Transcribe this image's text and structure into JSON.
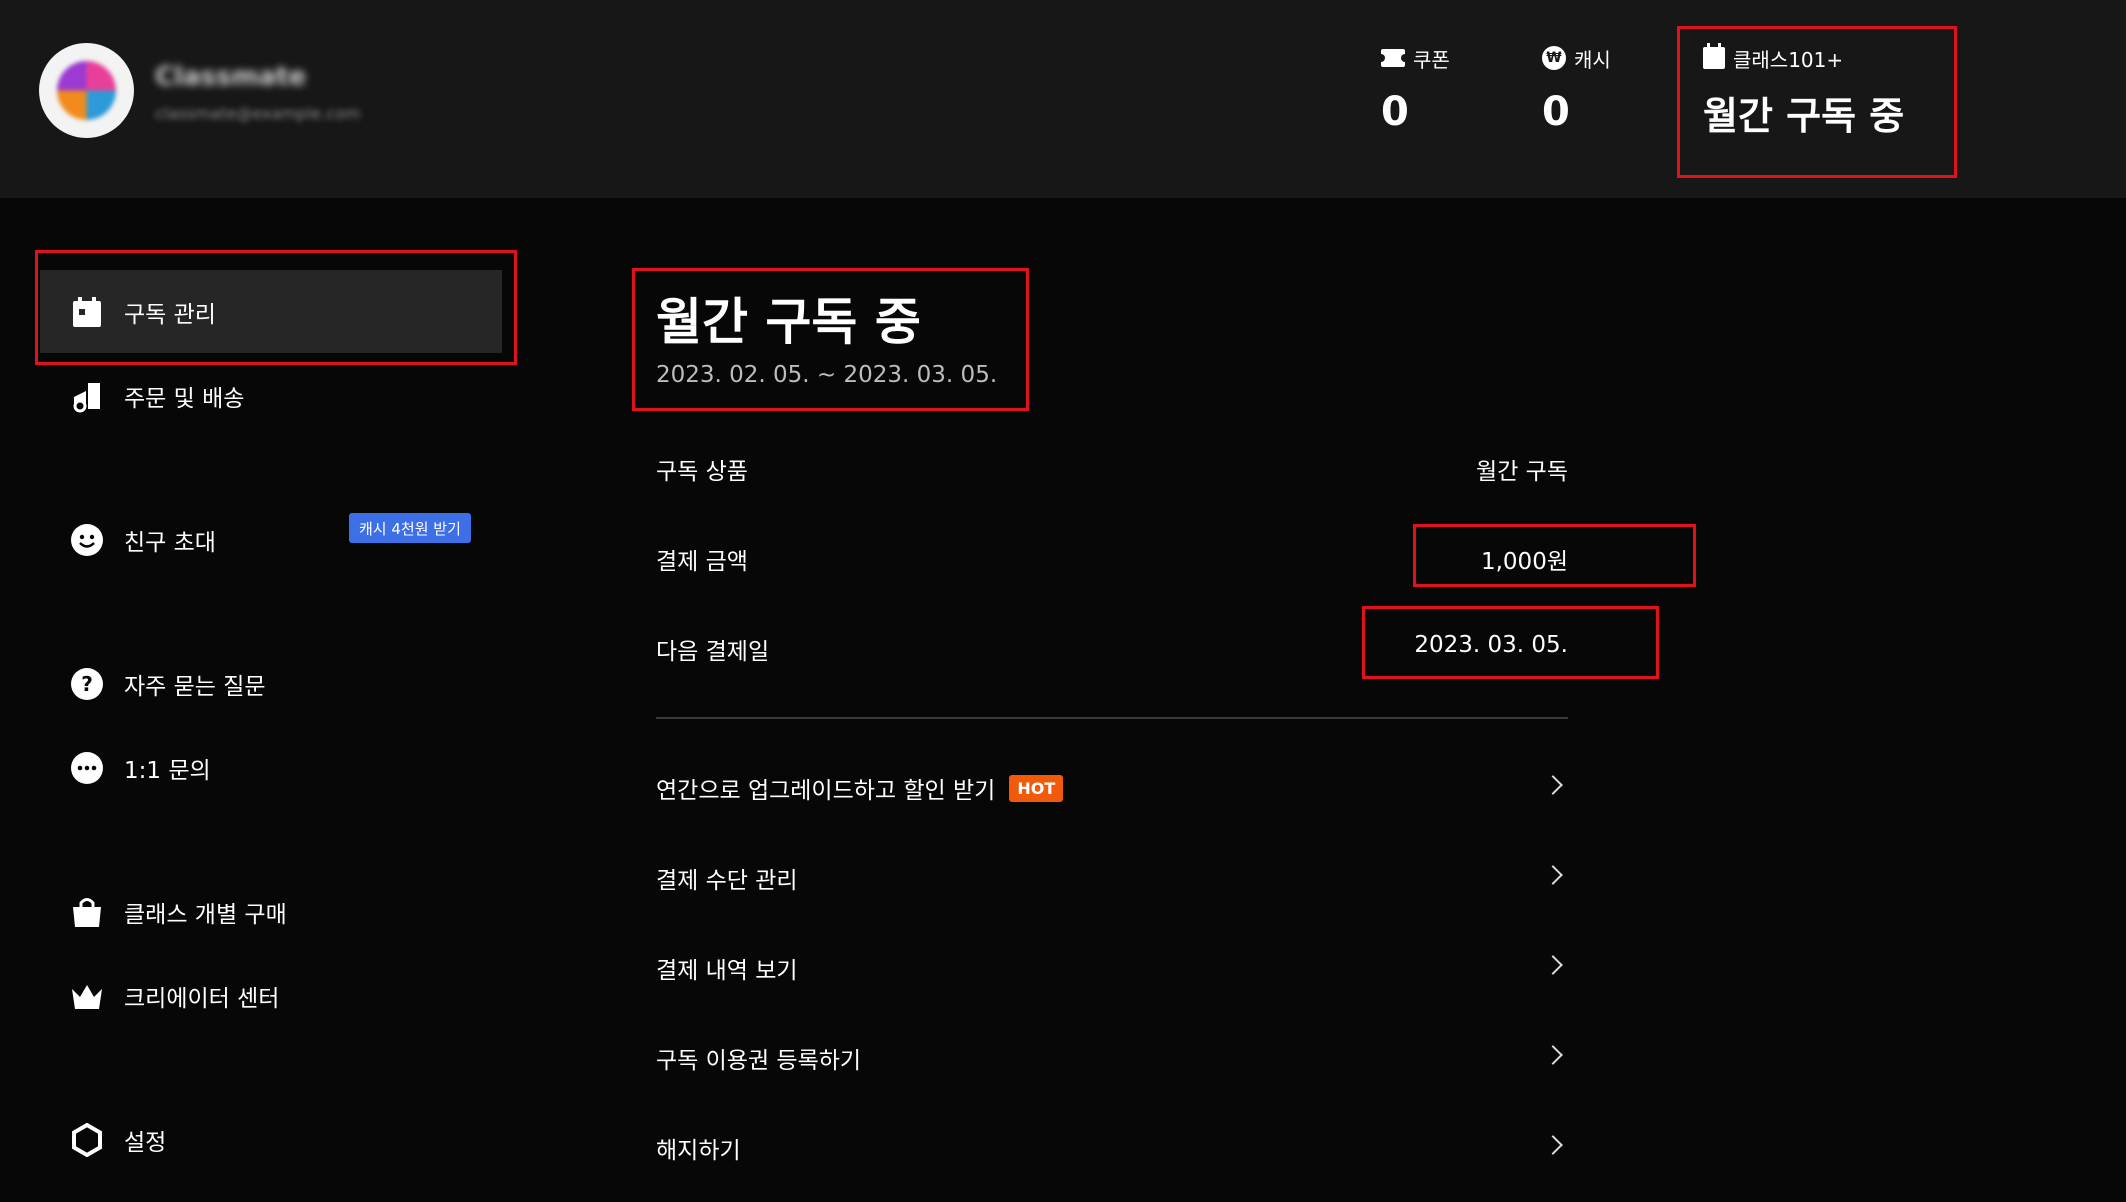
{
  "header": {
    "user_name": "Classmate",
    "user_email": "classmate@example.com",
    "stats": [
      {
        "label": "쿠폰",
        "value": "0",
        "icon": "coupon-icon"
      },
      {
        "label": "캐시",
        "value": "0",
        "icon": "won-icon"
      },
      {
        "label": "클래스101+",
        "value": "월간 구독 중",
        "icon": "calendar-icon"
      }
    ]
  },
  "sidebar": {
    "items": [
      {
        "label": "구독 관리",
        "icon": "calendar-icon",
        "active": true
      },
      {
        "label": "주문 및 배송",
        "icon": "delivery-icon"
      },
      {
        "label": "친구 초대",
        "icon": "smile-icon",
        "badge": "캐시 4천원 받기"
      },
      {
        "label": "자주 묻는 질문",
        "icon": "question-icon"
      },
      {
        "label": "1:1 문의",
        "icon": "chat-icon"
      },
      {
        "label": "클래스 개별 구매",
        "icon": "shopping-bag-icon"
      },
      {
        "label": "크리에이터 센터",
        "icon": "crown-icon"
      },
      {
        "label": "설정",
        "icon": "gear-icon"
      }
    ]
  },
  "main": {
    "title": "월간 구독 중",
    "period": "2023. 02. 05. ~ 2023. 03. 05.",
    "rows": [
      {
        "label": "구독 상품",
        "value": "월간 구독"
      },
      {
        "label": "결제 금액",
        "value": "1,000원"
      },
      {
        "label": "다음 결제일",
        "value": "2023. 03. 05."
      }
    ],
    "menu": [
      {
        "label": "연간으로 업그레이드하고 할인 받기",
        "badge": "HOT"
      },
      {
        "label": "결제 수단 관리"
      },
      {
        "label": "결제 내역 보기"
      },
      {
        "label": "구독 이용권 등록하기"
      },
      {
        "label": "해지하기"
      }
    ]
  },
  "colors": {
    "background": "#070707",
    "header_background": "#171717",
    "highlight_border": "#e0121b",
    "badge_blue": "#3d6fe6",
    "badge_hot": "#f05a0a"
  }
}
